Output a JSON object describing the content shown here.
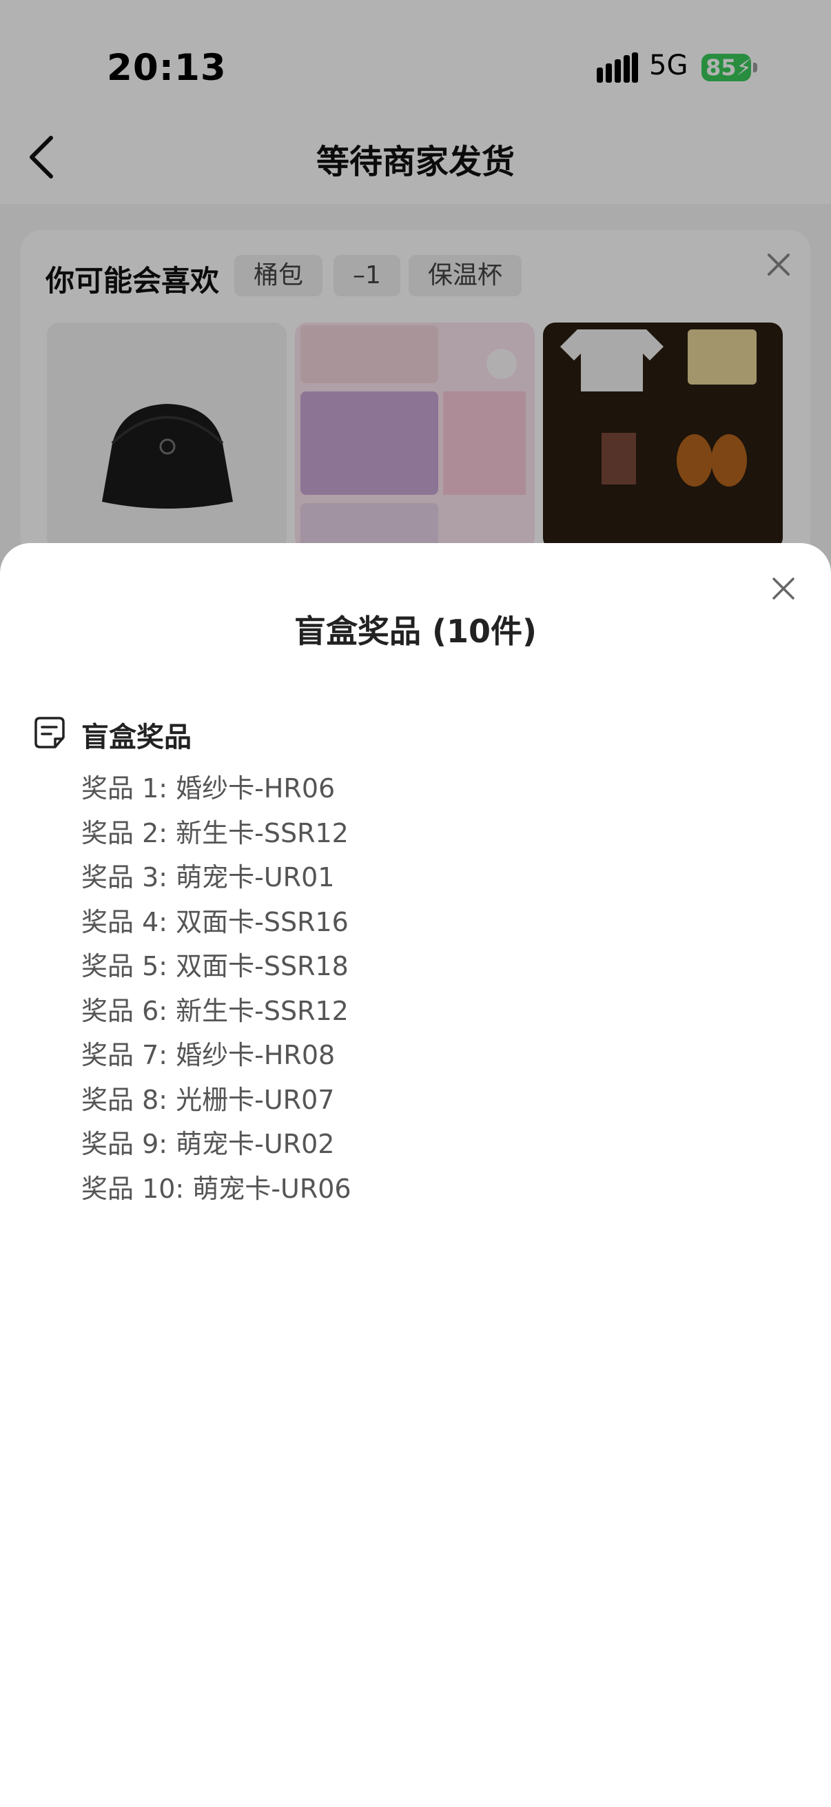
{
  "status_bar": {
    "time": "20:13",
    "network": "5G",
    "battery": "85"
  },
  "nav": {
    "title": "等待商家发货"
  },
  "recommend": {
    "title": "你可能会喜欢",
    "chips": [
      "桶包",
      "–1",
      "保温杯"
    ]
  },
  "sheet": {
    "title": "盲盒奖品 (10件)",
    "section_title": "盲盒奖品",
    "prizes": [
      "奖品 1: 婚纱卡-HR06",
      "奖品 2: 新生卡-SSR12",
      "奖品 3: 萌宠卡-UR01",
      "奖品 4: 双面卡-SSR16",
      "奖品 5: 双面卡-SSR18",
      "奖品 6: 新生卡-SSR12",
      "奖品 7: 婚纱卡-HR08",
      "奖品 8: 光栅卡-UR07",
      "奖品 9: 萌宠卡-UR02",
      "奖品 10: 萌宠卡-UR06"
    ]
  },
  "colors": {
    "battery": "#3ccb5b",
    "overlay": "rgba(0,0,0,0.30)"
  }
}
